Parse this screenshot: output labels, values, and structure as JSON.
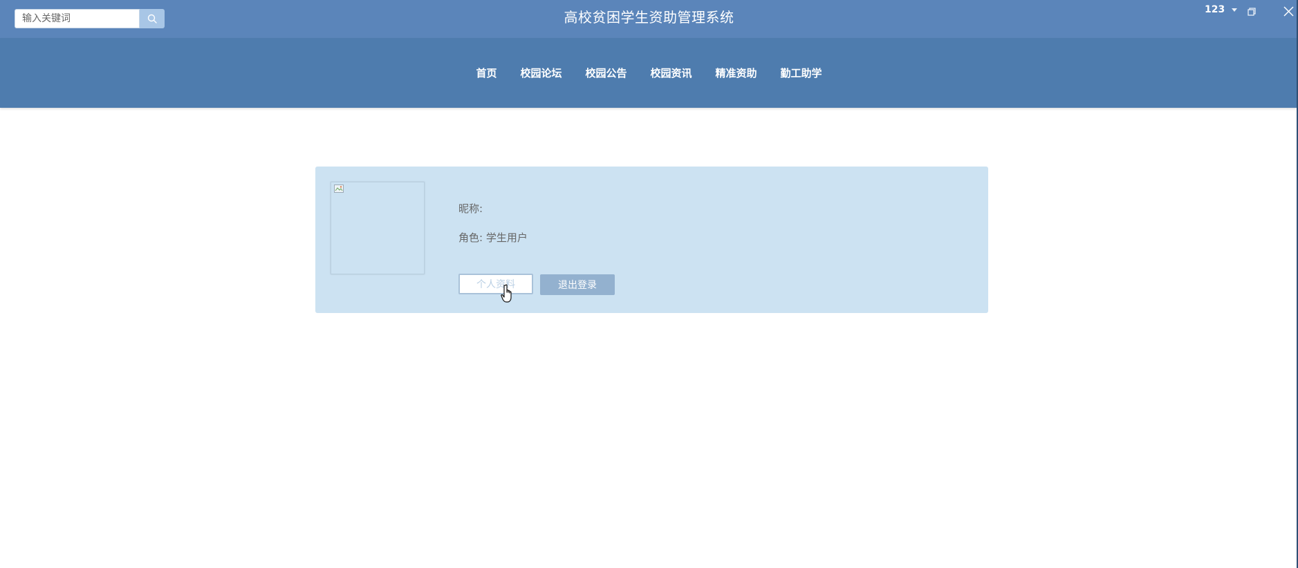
{
  "search": {
    "placeholder": "输入关键词"
  },
  "header": {
    "title": "高校贫困学生资助管理系统"
  },
  "window": {
    "user": "123"
  },
  "nav": {
    "items": [
      {
        "label": "首页"
      },
      {
        "label": "校园论坛"
      },
      {
        "label": "校园公告"
      },
      {
        "label": "校园资讯"
      },
      {
        "label": "精准资助"
      },
      {
        "label": "勤工助学"
      }
    ]
  },
  "profile": {
    "nickname_label": "昵称:",
    "role_text": "角色: 学生用户",
    "profile_button": "个人资料",
    "logout_button": "退出登录"
  },
  "colors": {
    "topbar": "#5b85ba",
    "navbar": "#4e7cae",
    "card": "#cce2f2",
    "logout_button": "#93b1cf"
  }
}
